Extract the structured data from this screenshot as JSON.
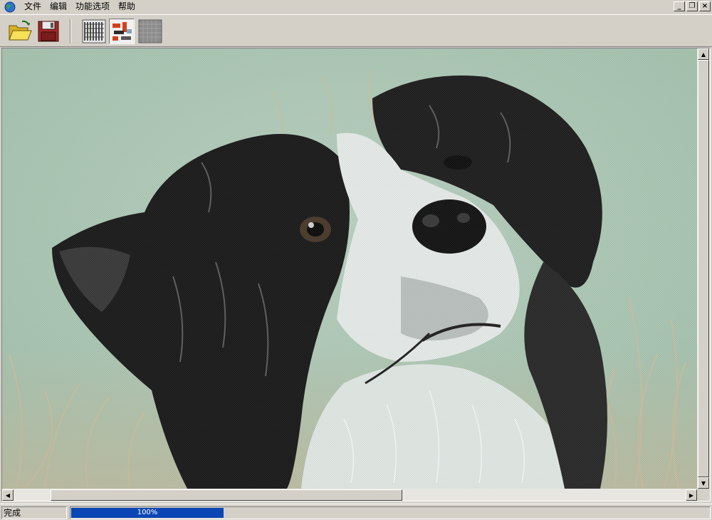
{
  "menubar": {
    "items": [
      {
        "label": "文件"
      },
      {
        "label": "编辑"
      },
      {
        "label": "功能选项"
      },
      {
        "label": "帮助"
      }
    ],
    "window_controls": {
      "minimize": "_",
      "restore": "❐",
      "close": "×"
    }
  },
  "toolbar": {
    "buttons": [
      {
        "icon": "open-folder-icon",
        "pressed": false
      },
      {
        "icon": "save-disk-icon",
        "pressed": false
      },
      {
        "icon": "pattern-grid-icon",
        "pressed": false
      },
      {
        "icon": "color-blocks-icon",
        "pressed": true
      },
      {
        "icon": "gray-grid-icon",
        "pressed": false
      }
    ]
  },
  "canvas": {
    "subject": "dog-portrait-image",
    "background_color": "#a9c7b4"
  },
  "scrollbars": {
    "up_arrow": "▲",
    "down_arrow": "▼",
    "left_arrow": "◀",
    "right_arrow": "▶"
  },
  "statusbar": {
    "status_text": "完成",
    "progress_label": "100%",
    "progress_value": 1.0,
    "progress_color": "#0a47b4"
  }
}
